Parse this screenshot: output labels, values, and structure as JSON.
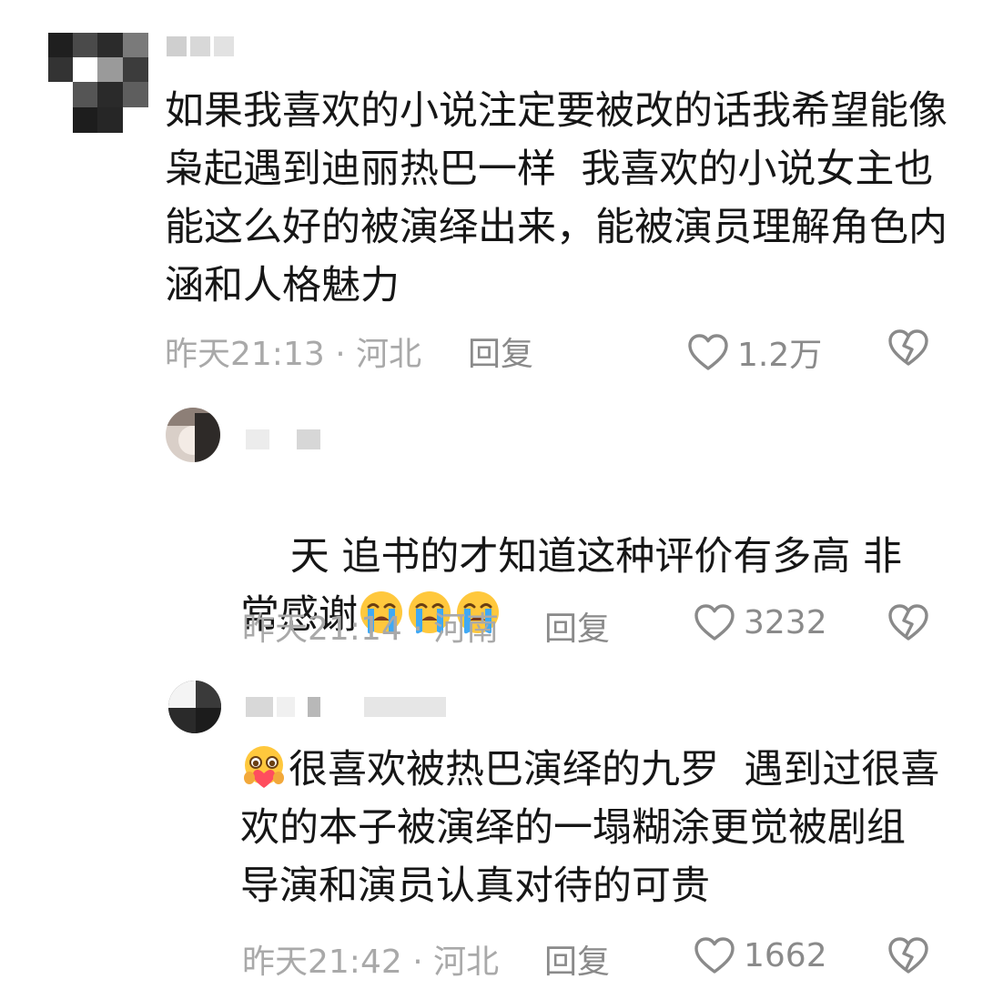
{
  "comments": [
    {
      "text": "如果我喜欢的小说注定要被改的话我希望能像枭起遇到迪丽热巴一样  我喜欢的小说女主也能这么好的被演绎出来，能被演员理解角色内涵和人格魅力",
      "time_location": "昨天21:13 · 河北",
      "reply_label": "回复",
      "likes": "1.2万"
    },
    {
      "text": "天 追书的才知道这种评价有多高 非常感谢",
      "emoji": [
        "loudly-crying-face-emoji",
        "loudly-crying-face-emoji",
        "loudly-crying-face-emoji"
      ],
      "time_location": "昨天21:14 · 河南",
      "reply_label": "回复",
      "likes": "3232"
    },
    {
      "text": "很喜欢被热巴演绎的九罗  遇到过很喜欢的本子被演绎的一塌糊涂更觉被剧组导演和演员认真对待的可贵",
      "leading_emoji": "hugging-heart-face-emoji",
      "time_location": "昨天21:42 · 河北",
      "reply_label": "回复",
      "likes": "1662"
    }
  ],
  "icons": {
    "like": "heart-outline-icon",
    "dislike": "broken-heart-icon"
  }
}
